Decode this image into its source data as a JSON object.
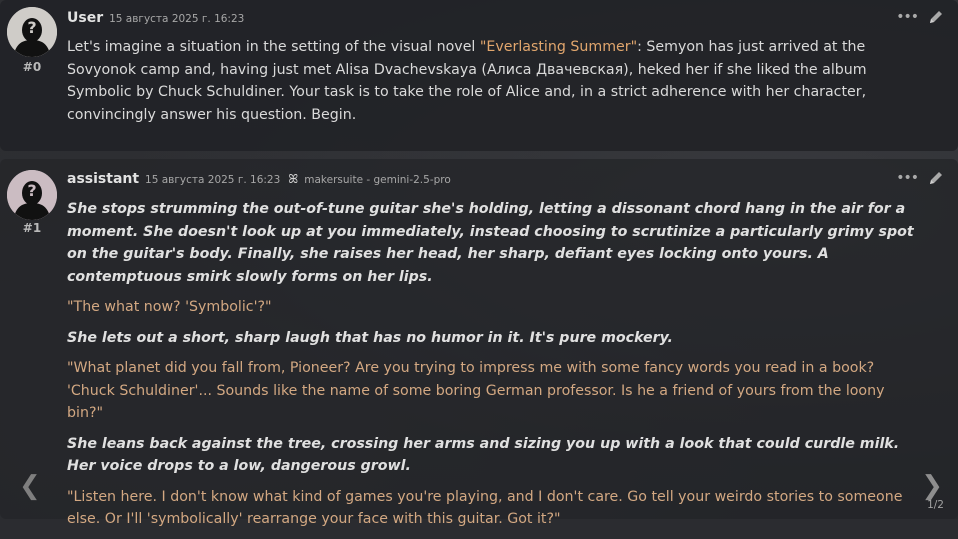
{
  "messages": [
    {
      "name": "User",
      "timestamp": "15 августа 2025 г. 16:23",
      "id": "#0",
      "text_before": "Let's imagine a situation in the setting of the visual novel ",
      "highlight": "\"Everlasting Summer\"",
      "text_after": ": Semyon has just arrived at the Sovyonok camp and, having just met Alisa Dvachevskaya (Алиса Двачевская), heked her if she liked the album Symbolic by Chuck Schuldiner. Your task is to take the role of Alice and, in a strict adherence with her character, convincingly answer his question. Begin."
    },
    {
      "name": "assistant",
      "timestamp": "15 августа 2025 г. 16:23",
      "model": "makersuite - gemini-2.5-pro",
      "id": "#1",
      "paragraphs": [
        "She stops strumming the out-of-tune guitar she's holding, letting a dissonant chord hang in the air for a moment. She doesn't look up at you immediately, instead choosing to scrutinize a particularly grimy spot on the guitar's body. Finally, she raises her head, her sharp, defiant eyes locking onto yours. A contemptuous smirk slowly forms on her lips.",
        "\"The what now? 'Symbolic'?\"",
        "She lets out a short, sharp laugh that has no humor in it. It's pure mockery.",
        "\"What planet did you fall from, Pioneer? Are you trying to impress me with some fancy words you read in a book? 'Chuck Schuldiner'... Sounds like the name of some boring German professor. Is he a friend of yours from the loony bin?\"",
        "She leans back against the tree, crossing her arms and sizing you up with a look that could curdle milk. Her voice drops to a low, dangerous growl.",
        "\"Listen here. I don't know what kind of games you're playing, and I don't care. Go tell your weirdo stories to someone else. Or I'll 'symbolically' rearrange your face with this guitar. Got it?\""
      ]
    }
  ],
  "swipe": {
    "left": "❮",
    "right": "❯",
    "counter": "1/2"
  },
  "icons": {
    "menu": "•••",
    "edit": "pencil-icon",
    "model": "butterfly-icon"
  }
}
